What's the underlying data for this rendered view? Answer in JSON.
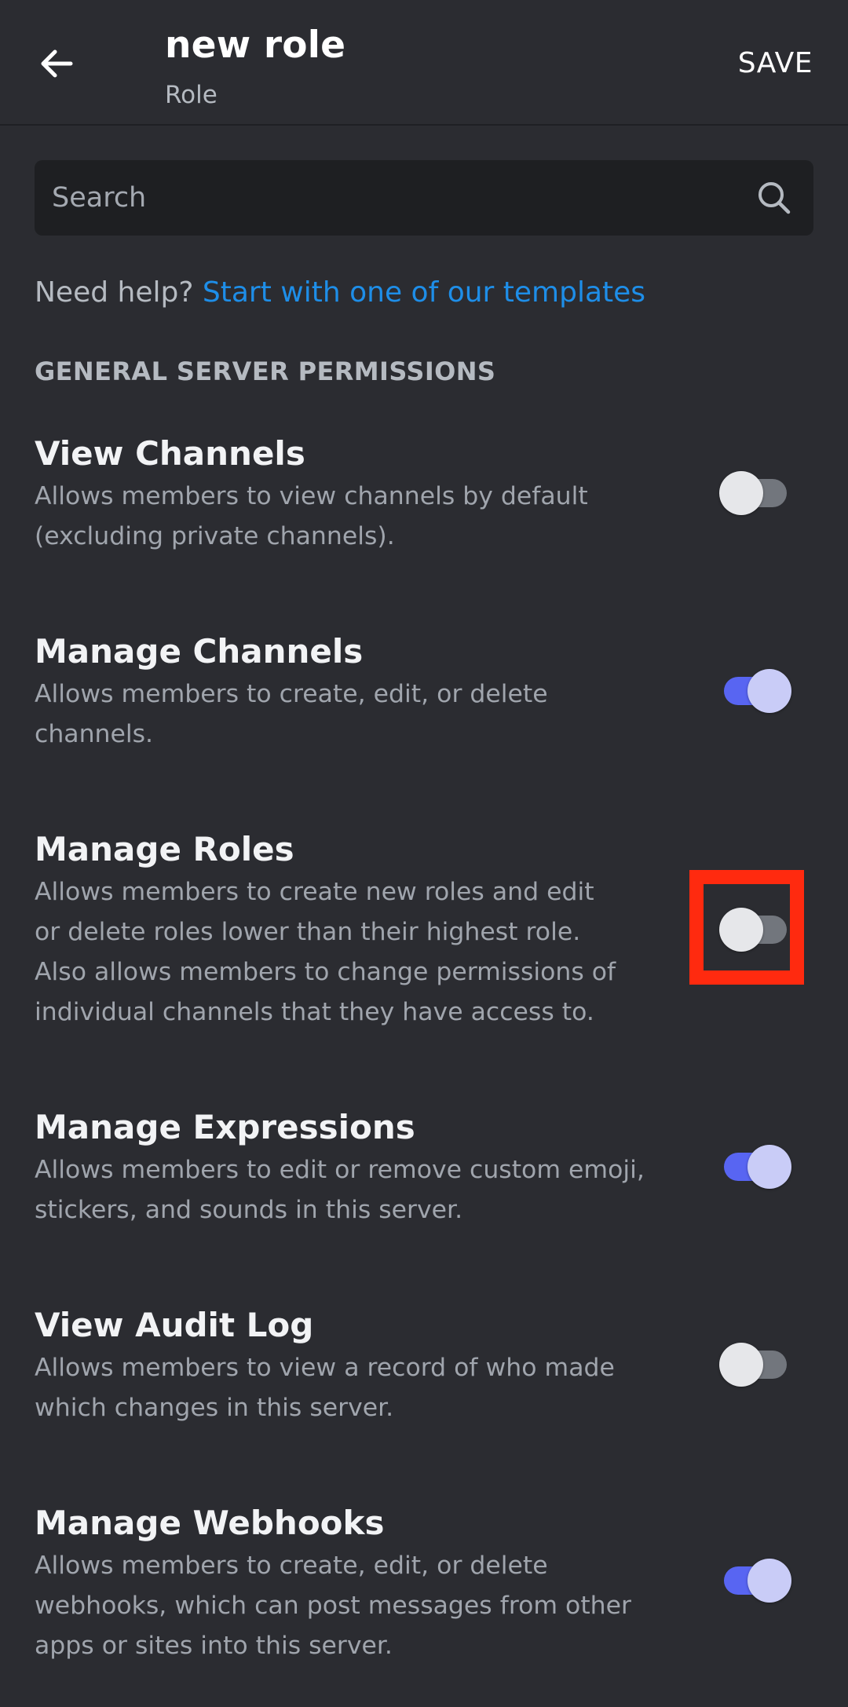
{
  "header": {
    "title": "new role",
    "subtitle": "Role",
    "save_label": "SAVE",
    "back_icon": "arrow-left-icon"
  },
  "search": {
    "placeholder": "Search",
    "value": "",
    "icon": "search-icon"
  },
  "help": {
    "prefix": "Need help?",
    "link_text": "Start with one of our templates"
  },
  "section": {
    "title": "GENERAL SERVER PERMISSIONS"
  },
  "permissions": [
    {
      "title": "View Channels",
      "desc_lines": [
        "Allows members to view channels by default",
        "(excluding private channels)."
      ],
      "enabled": false
    },
    {
      "title": "Manage Channels",
      "desc_lines": [
        "Allows members to create, edit, or delete",
        "channels."
      ],
      "enabled": true
    },
    {
      "title": "Manage Roles",
      "desc_lines": [
        "Allows members to create new roles and edit",
        "or delete roles lower than their highest role.",
        "Also allows members to change permissions of",
        "individual channels that they have access to."
      ],
      "enabled": false,
      "highlighted": true
    },
    {
      "title": "Manage Expressions",
      "desc_lines": [
        "Allows members to edit or remove custom emoji,",
        "stickers, and sounds in this server."
      ],
      "enabled": true
    },
    {
      "title": "View Audit Log",
      "desc_lines": [
        "Allows members to view a record of who made",
        "which changes in this server."
      ],
      "enabled": false
    },
    {
      "title": "Manage Webhooks",
      "desc_lines": [
        "Allows members to create, edit, or delete",
        "webhooks, which can post messages from other",
        "apps or sites into this server."
      ],
      "enabled": true
    }
  ],
  "colors": {
    "background": "#2b2c31",
    "search_background": "#1e1f22",
    "link": "#1e8ee8",
    "toggle_on_track": "#5865f2",
    "toggle_on_thumb": "#c9ccf7",
    "toggle_off_track": "#72767d",
    "toggle_off_thumb": "#e6e7ea",
    "highlight": "#ff2a0f"
  }
}
